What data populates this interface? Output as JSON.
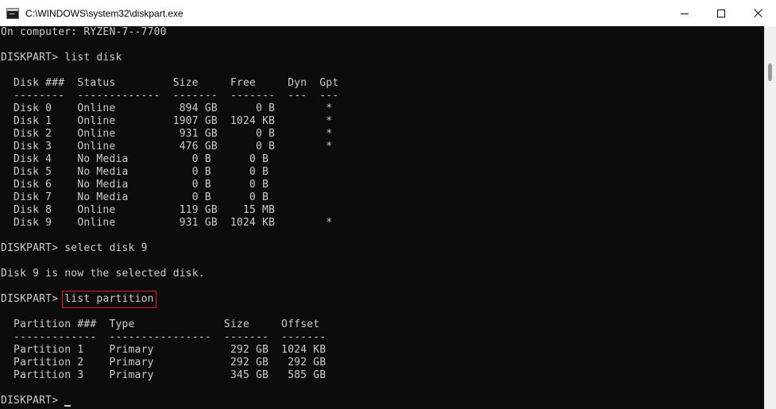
{
  "window": {
    "title": "C:\\WINDOWS\\system32\\diskpart.exe"
  },
  "icons": {
    "app": "console-app-icon",
    "minimize": "minimize-icon",
    "maximize": "maximize-icon",
    "close": "close-icon"
  },
  "console": {
    "lines": [
      "On computer: RYZEN-7--7700",
      "",
      "DISKPART> list disk",
      "",
      "  Disk ###  Status         Size     Free     Dyn  Gpt",
      "  --------  -------------  -------  -------  ---  ---",
      "  Disk 0    Online          894 GB      0 B        *",
      "  Disk 1    Online         1907 GB  1024 KB        *",
      "  Disk 2    Online          931 GB      0 B        *",
      "  Disk 3    Online          476 GB      0 B        *",
      "  Disk 4    No Media          0 B      0 B",
      "  Disk 5    No Media          0 B      0 B",
      "  Disk 6    No Media          0 B      0 B",
      "  Disk 7    No Media          0 B      0 B",
      "  Disk 8    Online          119 GB    15 MB",
      "  Disk 9    Online          931 GB  1024 KB        *",
      "",
      "DISKPART> select disk 9",
      "",
      "Disk 9 is now the selected disk.",
      ""
    ],
    "prompt": "DISKPART> ",
    "highlighted_command": "list partition",
    "lines_after": [
      "",
      "  Partition ###  Type              Size     Offset",
      "  -------------  ----------------  -------  -------",
      "  Partition 1    Primary            292 GB  1024 KB",
      "  Partition 2    Primary            292 GB   292 GB",
      "  Partition 3    Primary            345 GB   585 GB",
      ""
    ],
    "final_prompt": "DISKPART> "
  },
  "colors": {
    "background": "#0c0c0c",
    "text": "#cccccc",
    "highlight": "#e81123"
  }
}
